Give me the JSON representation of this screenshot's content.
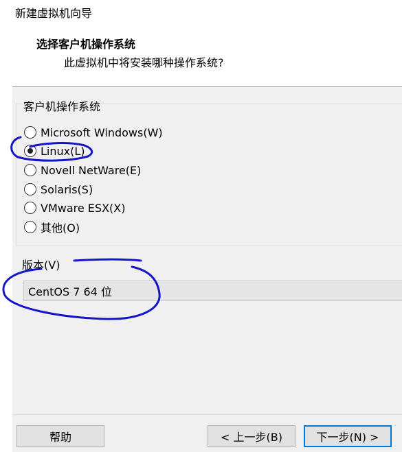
{
  "window": {
    "title": "新建虚拟机向导"
  },
  "header": {
    "title": "选择客户机操作系统",
    "subtitle": "此虚拟机中将安装哪种操作系统?"
  },
  "guest_os": {
    "group_label": "客户机操作系统",
    "options": [
      {
        "label": "Microsoft Windows(W)",
        "checked": false
      },
      {
        "label": "Linux(L)",
        "checked": true
      },
      {
        "label": "Novell NetWare(E)",
        "checked": false
      },
      {
        "label": "Solaris(S)",
        "checked": false
      },
      {
        "label": "VMware ESX(X)",
        "checked": false
      },
      {
        "label": "其他(O)",
        "checked": false
      }
    ]
  },
  "version": {
    "label": "版本(V)",
    "selected": "CentOS 7 64 位"
  },
  "footer": {
    "help_label": "帮助",
    "back_label": "< 上一步(B)",
    "next_label": "下一步(N) >"
  },
  "annotation": {
    "color": "#1414c8"
  }
}
